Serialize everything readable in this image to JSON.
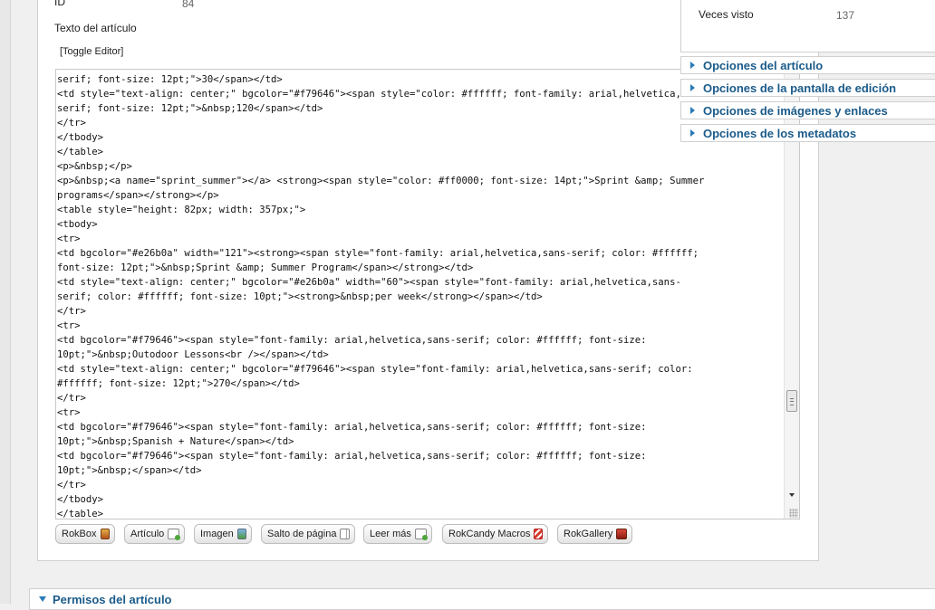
{
  "article": {
    "id_label": "ID",
    "id_value": "84",
    "text_label": "Texto del artículo",
    "toggle_editor": "[Toggle Editor]"
  },
  "editor": {
    "lines": [
      "serif; font-size: 12pt;\">30</span></td>",
      "<td style=\"text-align: center;\" bgcolor=\"#f79646\"><span style=\"color: #ffffff; font-family: arial,helvetica,sans-",
      "serif; font-size: 12pt;\">&nbsp;120</span></td>",
      "</tr>",
      "</tbody>",
      "</table>",
      "<p>&nbsp;</p>",
      "<p>&nbsp;<a name=\"sprint_summer\"></a> <strong><span style=\"color: #ff0000; font-size: 14pt;\">Sprint &amp; Summer",
      "programs</span></strong></p>",
      "<table style=\"height: 82px; width: 357px;\">",
      "<tbody>",
      "<tr>",
      "<td bgcolor=\"#e26b0a\" width=\"121\"><strong><span style=\"font-family: arial,helvetica,sans-serif; color: #ffffff;",
      "font-size: 12pt;\">&nbsp;Sprint &amp; Summer Program</span></strong></td>",
      "<td style=\"text-align: center;\" bgcolor=\"#e26b0a\" width=\"60\"><span style=\"font-family: arial,helvetica,sans-",
      "serif; color: #ffffff; font-size: 10pt;\"><strong>&nbsp;per week</strong></span></td>",
      "</tr>",
      "<tr>",
      "<td bgcolor=\"#f79646\"><span style=\"font-family: arial,helvetica,sans-serif; color: #ffffff; font-size:",
      "10pt;\">&nbsp;Outodoor Lessons<br /></span></td>",
      "<td style=\"text-align: center;\" bgcolor=\"#f79646\"><span style=\"font-family: arial,helvetica,sans-serif; color:",
      "#ffffff; font-size: 12pt;\">270</span></td>",
      "</tr>",
      "<tr>",
      "<td bgcolor=\"#f79646\"><span style=\"font-family: arial,helvetica,sans-serif; color: #ffffff; font-size:",
      "10pt;\">&nbsp;Spanish + Nature</span></td>",
      "<td bgcolor=\"#f79646\"><span style=\"font-family: arial,helvetica,sans-serif; color: #ffffff; font-size:",
      "10pt;\">&nbsp;</span></td>",
      "</tr>",
      "</tbody>",
      "</table>"
    ]
  },
  "buttons": {
    "rokbox": "RokBox",
    "articulo": "Artículo",
    "imagen": "Imagen",
    "salto": "Salto de página",
    "leer": "Leer más",
    "rokcandy": "RokCandy Macros",
    "rokgallery": "RokGallery"
  },
  "sidebar": {
    "views_label": "Veces visto",
    "views_value": "137",
    "options": [
      "Opciones del artículo",
      "Opciones de la pantalla de edición",
      "Opciones de imágenes y enlaces",
      "Opciones de los metadatos"
    ]
  },
  "permissions": {
    "title": "Permisos del artículo"
  },
  "icons": {
    "rokbox": "rokbox-icon",
    "articulo": "article-icon",
    "imagen": "image-icon",
    "salto": "pagebreak-icon",
    "leer": "readmore-icon",
    "rokcandy": "rokcandy-icon",
    "rokgallery": "rokgallery-icon"
  }
}
